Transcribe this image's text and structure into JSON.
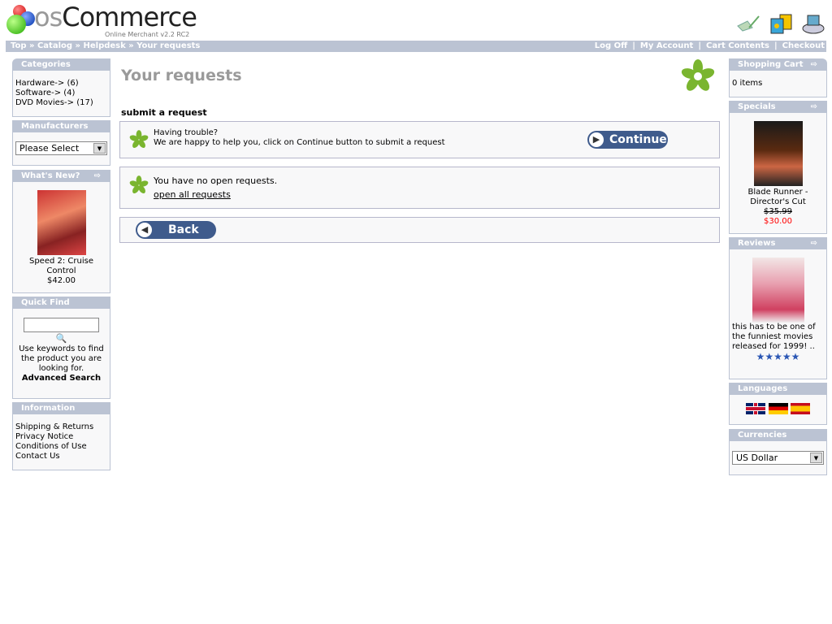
{
  "header": {
    "logo_text": "osCommerce",
    "tagline": "Online Merchant v2.2 RC2",
    "icons": [
      "checkout-pen-icon",
      "shopping-bags-icon",
      "account-icon"
    ]
  },
  "breadcrumb": [
    "Top",
    "Catalog",
    "Helpdesk",
    "Your requests"
  ],
  "breadcrumb_sep": "»",
  "header_links": [
    "Log Off",
    "My Account",
    "Cart Contents",
    "Checkout"
  ],
  "left": {
    "categories": {
      "title": "Categories",
      "items": [
        "Hardware-> (6)",
        "Software-> (4)",
        "DVD Movies-> (17)"
      ]
    },
    "manufacturers": {
      "title": "Manufacturers",
      "select_value": "Please Select"
    },
    "whats_new": {
      "title": "What's New?",
      "product": "Speed 2: Cruise Control",
      "price": "$42.00"
    },
    "quick_find": {
      "title": "Quick Find",
      "input_value": "",
      "help": "Use keywords to find the product you are looking for.",
      "advanced": "Advanced Search"
    },
    "information": {
      "title": "Information",
      "items": [
        "Shipping & Returns",
        "Privacy Notice",
        "Conditions of Use",
        "Contact Us"
      ]
    }
  },
  "main": {
    "title": "Your requests",
    "section": "submit a request",
    "trouble_1": "Having trouble?",
    "trouble_2": "We are happy to help you, click on Continue button to submit a request",
    "continue": "Continue",
    "no_requests": "You have no open requests.",
    "open_all": "open all requests",
    "back": "Back"
  },
  "right": {
    "cart": {
      "title": "Shopping Cart",
      "text": "0 items"
    },
    "specials": {
      "title": "Specials",
      "product": "Blade Runner - Director's Cut",
      "old_price": "$35.99",
      "new_price": "$30.00"
    },
    "reviews": {
      "title": "Reviews",
      "text": "this has to be one of the funniest movies released for 1999! ..",
      "rating": 5
    },
    "languages": {
      "title": "Languages",
      "items": [
        "English",
        "Deutsch",
        "Español"
      ]
    },
    "currencies": {
      "title": "Currencies",
      "select_value": "US Dollar"
    }
  },
  "colors": {
    "box_header": "#bbc3d3",
    "special_price": "#ff0000",
    "button": "#3f5b8c",
    "accent_green": "#7ab52f"
  }
}
